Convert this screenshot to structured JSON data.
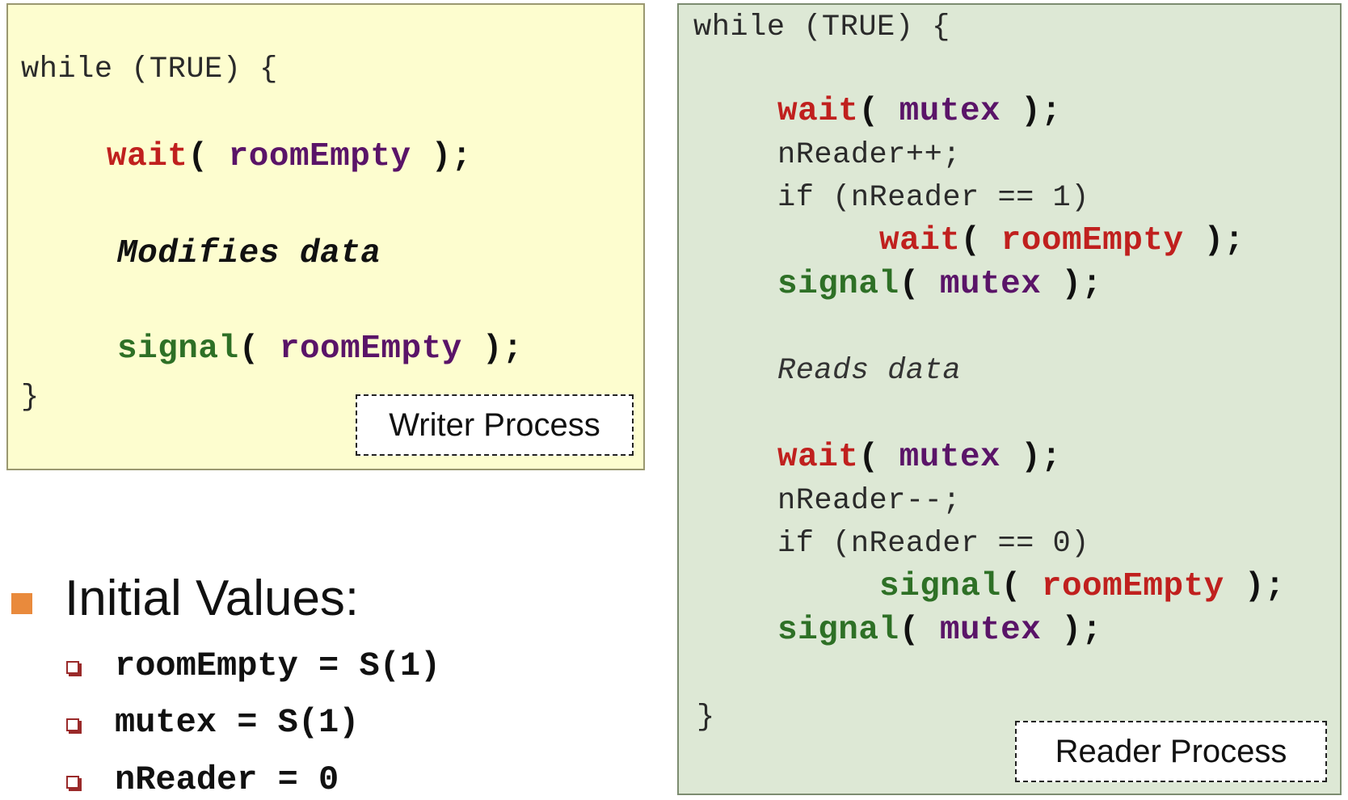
{
  "writer": {
    "line1": "while (TRUE) {",
    "wait_kw": "wait",
    "wait_open": "( ",
    "wait_arg": "roomEmpty",
    "wait_close": " );",
    "modifies": "Modifies data",
    "signal_kw": "signal",
    "signal_open": "( ",
    "signal_arg": "roomEmpty",
    "signal_close": " );",
    "end": "}",
    "label": "Writer Process"
  },
  "reader": {
    "line1": "while (TRUE) {",
    "l_wait1_kw": "wait",
    "l_wait1_open": "( ",
    "l_wait1_arg": "mutex",
    "l_wait1_close": " );",
    "l_inc": "nReader++;",
    "l_if1": "if (nReader == 1)",
    "l_wait2_kw": "wait",
    "l_wait2_open": "( ",
    "l_wait2_arg": "roomEmpty",
    "l_wait2_close": " );",
    "l_sig1_kw": "signal",
    "l_sig1_open": "( ",
    "l_sig1_arg": "mutex",
    "l_sig1_close": " );",
    "l_reads": "Reads data",
    "l_wait3_kw": "wait",
    "l_wait3_open": "( ",
    "l_wait3_arg": "mutex",
    "l_wait3_close": " );",
    "l_dec": "nReader--;",
    "l_if2": "if (nReader == 0)",
    "l_sig2_kw": "signal",
    "l_sig2_open": "( ",
    "l_sig2_arg": "roomEmpty",
    "l_sig2_close": " );",
    "l_sig3_kw": "signal",
    "l_sig3_open": "( ",
    "l_sig3_arg": "mutex",
    "l_sig3_close": " );",
    "end": "}",
    "label": "Reader Process"
  },
  "initial": {
    "title": "Initial Values:",
    "items": [
      "roomEmpty = S(1)",
      "mutex = S(1)",
      "nReader = 0"
    ]
  },
  "colors": {
    "writer_bg": "#fdfdcf",
    "reader_bg": "#dde8d5",
    "wait_red": "#c0201e",
    "signal_green": "#2e7026",
    "var_purple": "#5a1468",
    "bullet_orange": "#e98a3c"
  }
}
